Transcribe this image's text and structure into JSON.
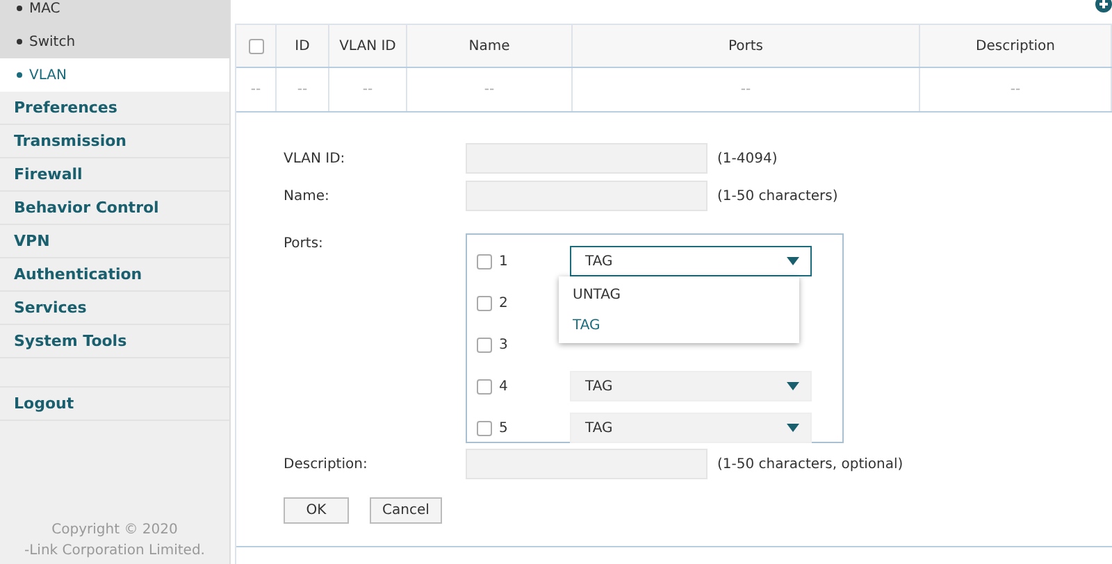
{
  "sidebar": {
    "sub_items": [
      {
        "label": "MAC",
        "selected": false
      },
      {
        "label": "Switch",
        "selected": false
      },
      {
        "label": "VLAN",
        "selected": true
      }
    ],
    "items": [
      "Preferences",
      "Transmission",
      "Firewall",
      "Behavior Control",
      "VPN",
      "Authentication",
      "Services",
      "System Tools"
    ],
    "logout": "Logout",
    "copyright": [
      "Copyright © 2020",
      "-Link Corporation Limited."
    ]
  },
  "table": {
    "select_all": {
      "checked": false
    },
    "columns": [
      "ID",
      "VLAN ID",
      "Name",
      "Ports",
      "Description"
    ],
    "row": [
      "--",
      "--",
      "--",
      "--",
      "--",
      "--"
    ]
  },
  "form": {
    "vlan_id": {
      "label": "VLAN ID:",
      "hint": "(1-4094)"
    },
    "name": {
      "label": "Name:",
      "hint": "(1-50 characters)"
    },
    "ports_label": "Ports:",
    "ports": [
      {
        "number": "1",
        "checked": false,
        "mode": "TAG",
        "open": true
      },
      {
        "number": "2",
        "checked": false
      },
      {
        "number": "3",
        "checked": false
      },
      {
        "number": "4",
        "checked": false,
        "mode": "TAG",
        "open": false
      },
      {
        "number": "5",
        "checked": false,
        "mode": "TAG",
        "open": false
      }
    ],
    "dropdown_options": [
      {
        "label": "UNTAG",
        "selected": false
      },
      {
        "label": "TAG",
        "selected": true
      }
    ],
    "description": {
      "label": "Description:",
      "hint": "(1-50 characters, optional)"
    },
    "buttons": [
      "OK",
      "Cancel"
    ]
  }
}
